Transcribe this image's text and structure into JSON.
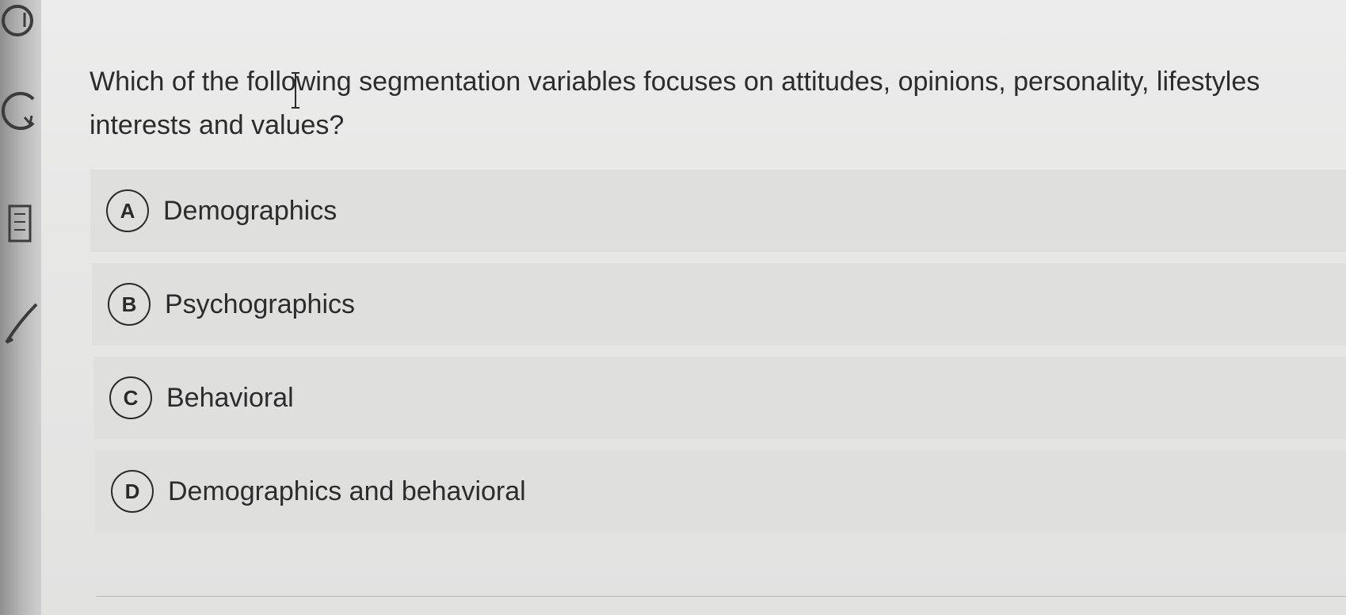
{
  "question": {
    "text": "Which of the following segmentation variables focuses on attitudes, opinions, personality, lifestyles\ninterests and values?"
  },
  "options": [
    {
      "letter": "A",
      "label": "Demographics"
    },
    {
      "letter": "B",
      "label": "Psychographics"
    },
    {
      "letter": "C",
      "label": "Behavioral"
    },
    {
      "letter": "D",
      "label": "Demographics and behavioral"
    }
  ],
  "sidebar_icons": [
    "timer-icon",
    "back-icon",
    "calculator-icon",
    "pencil-icon"
  ],
  "colors": {
    "background": "#e7e7e6",
    "option_background": "#dfdfdd",
    "text": "#2c2c2c"
  }
}
